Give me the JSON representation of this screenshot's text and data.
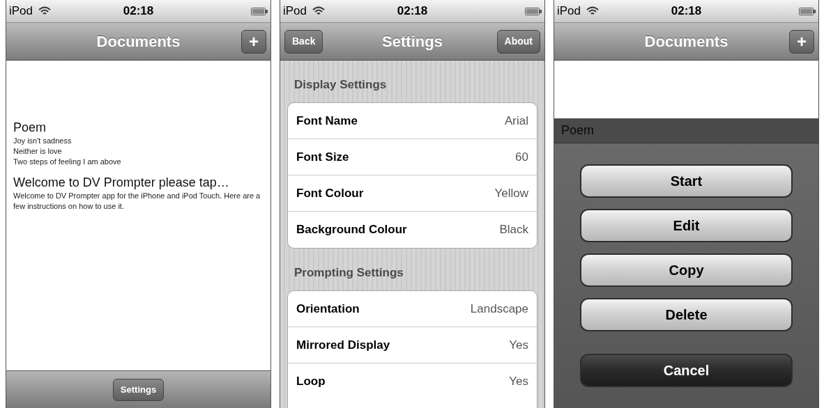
{
  "screens": [
    {
      "kind": "documents",
      "status": {
        "carrier": "iPod",
        "time": "02:18"
      },
      "nav": {
        "title": "Documents",
        "right_button": "+"
      },
      "documents": [
        {
          "title": "Poem",
          "lines": [
            "Joy isn't sadness",
            "Neither is love",
            "Two steps of feeling I am above"
          ]
        },
        {
          "title": "Welcome to DV Prompter please tap…",
          "lines": [
            "Welcome to DV Prompter app for the iPhone and iPod Touch. Here are a few instructions on how to use it."
          ]
        }
      ],
      "toolbar": {
        "button": "Settings"
      }
    },
    {
      "kind": "settings",
      "status": {
        "carrier": "iPod",
        "time": "02:18"
      },
      "nav": {
        "title": "Settings",
        "left_button": "Back",
        "right_button": "About"
      },
      "sections": [
        {
          "header": "Display Settings",
          "rows": [
            {
              "label": "Font Name",
              "value": "Arial"
            },
            {
              "label": "Font Size",
              "value": "60"
            },
            {
              "label": "Font Colour",
              "value": "Yellow"
            },
            {
              "label": "Background Colour",
              "value": "Black"
            }
          ]
        },
        {
          "header": "Prompting Settings",
          "rows": [
            {
              "label": "Orientation",
              "value": "Landscape"
            },
            {
              "label": "Mirrored Display",
              "value": "Yes"
            },
            {
              "label": "Loop",
              "value": "Yes"
            }
          ]
        }
      ]
    },
    {
      "kind": "action_sheet",
      "status": {
        "carrier": "iPod",
        "time": "02:18"
      },
      "nav": {
        "title": "Documents",
        "right_button": "+"
      },
      "documents": [
        {
          "title": "Poem"
        }
      ],
      "action_sheet": {
        "buttons": [
          {
            "label": "Start",
            "kind": "normal"
          },
          {
            "label": "Edit",
            "kind": "normal"
          },
          {
            "label": "Copy",
            "kind": "normal"
          },
          {
            "label": "Delete",
            "kind": "normal"
          },
          {
            "label": "Cancel",
            "kind": "cancel"
          }
        ]
      }
    }
  ]
}
